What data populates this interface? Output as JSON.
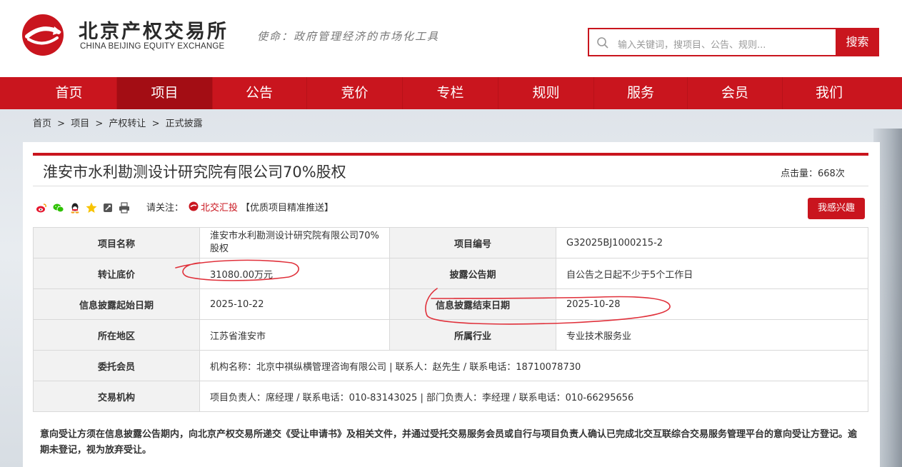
{
  "header": {
    "logo_cn": "北京产权交易所",
    "logo_en": "CHINA BEIJING EQUITY EXCHANGE",
    "mission": "使命：政府管理经济的市场化工具",
    "search_placeholder": "输入关键词，搜项目、公告、规则...",
    "search_button": "搜索"
  },
  "nav": [
    "首页",
    "项目",
    "公告",
    "竞价",
    "专栏",
    "规则",
    "服务",
    "会员",
    "我们"
  ],
  "nav_active": "项目",
  "breadcrumb": [
    "首页",
    ">",
    "项目",
    ">",
    "产权转让",
    ">",
    "正式披露"
  ],
  "project": {
    "title": "淮安市水利勘测设计研究院有限公司70%股权",
    "clicks": "点击量：668次",
    "follow_label": "请关注：",
    "follow_brand": "北交汇投",
    "follow_extra": "【优质项目精准推送】",
    "interest_button": "我感兴趣"
  },
  "share_icons": [
    "weibo-icon",
    "wechat-icon",
    "qq-icon",
    "qzone-icon",
    "bookmark-icon",
    "print-icon"
  ],
  "table": {
    "rows": [
      {
        "l1": "项目名称",
        "v1": "淮安市水利勘测设计研究院有限公司70%股权",
        "l2": "项目编号",
        "v2": "G32025BJ1000215-2"
      },
      {
        "l1": "转让底价",
        "v1": "31080.00万元",
        "l2": "披露公告期",
        "v2": "自公告之日起不少于5个工作日"
      },
      {
        "l1": "信息披露起始日期",
        "v1": "2025-10-22",
        "l2": "信息披露结束日期",
        "v2": "2025-10-28"
      },
      {
        "l1": "所在地区",
        "v1": "江苏省淮安市",
        "l2": "所属行业",
        "v2": "专业技术服务业"
      },
      {
        "l1": "委托会员",
        "v1": "机构名称：北京中祺纵横管理咨询有限公司 | 联系人：赵先生 / 联系电话：18710078730"
      },
      {
        "l1": "交易机构",
        "v1": "项目负责人：席经理 / 联系电话：010-83143025 | 部门负责人：李经理 / 联系电话：010-66295656"
      }
    ]
  },
  "note": "意向受让方须在信息披露公告期内，向北京产权交易所递交《受让申请书》及相关文件，并通过受托交易服务会员或自行与项目负责人确认已完成北交互联综合交易服务管理平台的意向受让方登记。逾期未登记，视为放弃受让。",
  "colors": {
    "brand_red": "#c9151e",
    "nav_active": "#a30d14",
    "annot_red": "#e0303a"
  }
}
